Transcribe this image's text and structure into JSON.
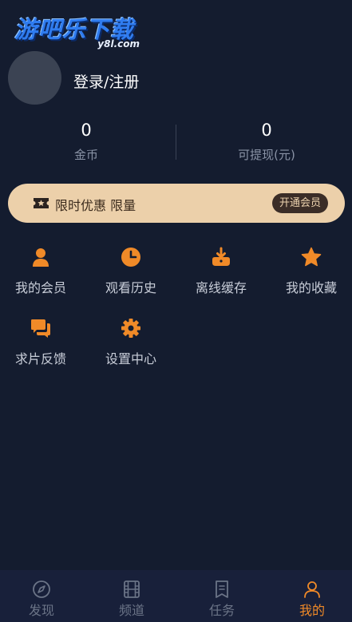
{
  "logo": {
    "main": "游吧乐下载",
    "sub": "y8l.com"
  },
  "profile": {
    "login_label": "登录/注册"
  },
  "stats": [
    {
      "value": "0",
      "label": "金币"
    },
    {
      "value": "0",
      "label": "可提现(元)"
    }
  ],
  "vip_bar": {
    "text": "限时优惠 限量",
    "button": "开通会员",
    "bg_color": "#ecd0aa"
  },
  "menu": [
    {
      "label": "我的会员",
      "icon": "user-icon"
    },
    {
      "label": "观看历史",
      "icon": "clock-icon"
    },
    {
      "label": "离线缓存",
      "icon": "download-icon"
    },
    {
      "label": "我的收藏",
      "icon": "star-icon"
    },
    {
      "label": "求片反馈",
      "icon": "feedback-icon"
    },
    {
      "label": "设置中心",
      "icon": "gear-icon"
    }
  ],
  "tabs": [
    {
      "label": "发现",
      "icon": "compass-icon",
      "active": false
    },
    {
      "label": "频道",
      "icon": "film-icon",
      "active": false
    },
    {
      "label": "任务",
      "icon": "task-icon",
      "active": false
    },
    {
      "label": "我的",
      "icon": "person-icon",
      "active": true
    }
  ],
  "colors": {
    "accent": "#f08a28",
    "background": "#141c2f",
    "inactive_tab": "#6b7487"
  }
}
